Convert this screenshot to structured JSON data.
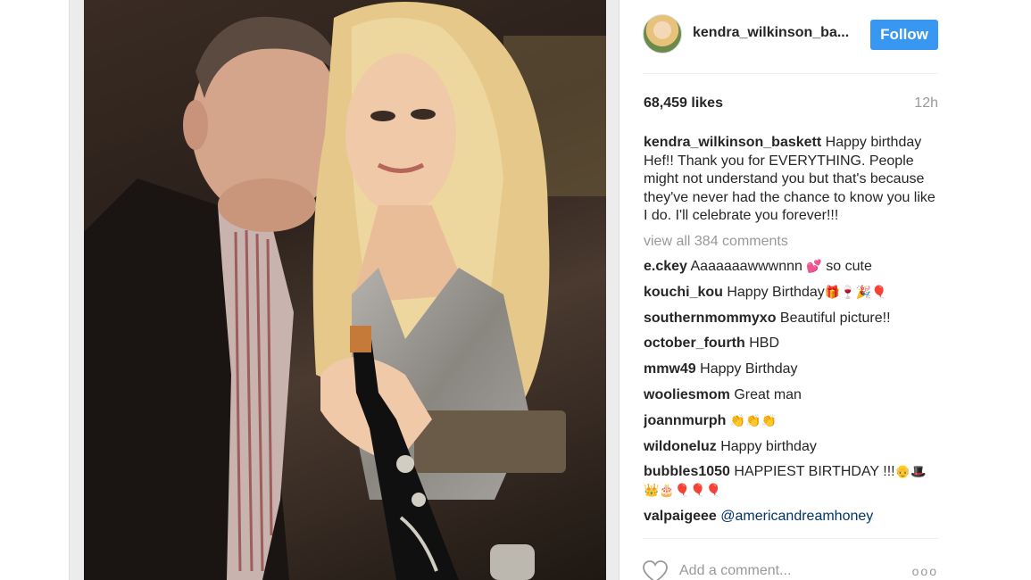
{
  "post": {
    "username_short": "kendra_wilkinson_ba...",
    "follow_label": "Follow",
    "likes": "68,459 likes",
    "time": "12h",
    "caption_user": "kendra_wilkinson_baskett",
    "caption_text": " Happy birthday Hef!! Thank you for EVERYTHING. People might not understand you but that's because they've never had the chance to know you like I do. I'll celebrate you forever!!!",
    "view_all": "view all 384 comments",
    "comments": [
      {
        "user": "e.ckey",
        "text": " Aaaaaaawwwnnn ",
        "emoji": "💕",
        "tail": " so cute"
      },
      {
        "user": "kouchi_kou",
        "text": " Happy Birthday",
        "emoji": "🎁🍷🎉🎈",
        "tail": ""
      },
      {
        "user": "southernmommyxo",
        "text": " Beautiful picture!!",
        "emoji": "",
        "tail": ""
      },
      {
        "user": "october_fourth",
        "text": " HBD",
        "emoji": "",
        "tail": ""
      },
      {
        "user": "mmw49",
        "text": " Happy Birthday",
        "emoji": "",
        "tail": ""
      },
      {
        "user": "wooliesmom",
        "text": " Great man",
        "emoji": "",
        "tail": ""
      },
      {
        "user": "joannmurph",
        "text": " ",
        "emoji": "👏👏👏",
        "tail": ""
      },
      {
        "user": "wildoneluz",
        "text": " Happy birthday",
        "emoji": "",
        "tail": ""
      },
      {
        "user": "bubbles1050",
        "text": " HAPPIEST BIRTHDAY !!!",
        "emoji": "👴🎩👑🎂🎈🎈🎈",
        "tail": ""
      },
      {
        "user": "valpaigeee",
        "text": " ",
        "emoji": "",
        "tail": "",
        "mention": "@americandreamhoney"
      }
    ],
    "add_comment_placeholder": "Add a comment...",
    "more_label": "ooo"
  },
  "icons": {
    "heart": "heart-icon",
    "more": "more-options-icon"
  },
  "colors": {
    "follow_bg": "#3897f0",
    "muted": "#999999",
    "text": "#262626"
  }
}
